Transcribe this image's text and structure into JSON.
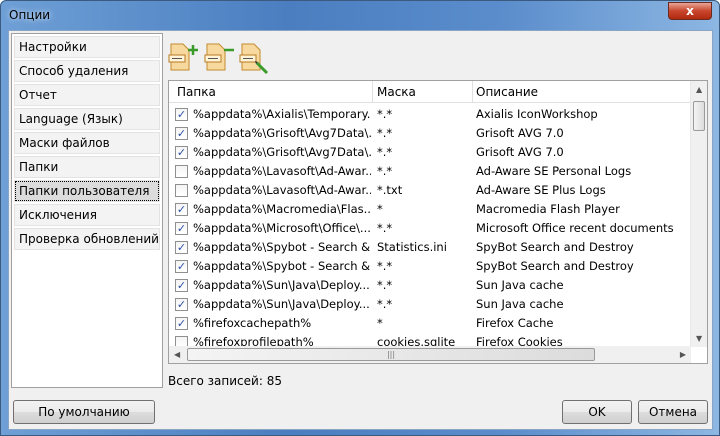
{
  "window": {
    "title": "Опции",
    "close_label": "x"
  },
  "sidebar": {
    "items": [
      {
        "label": "Настройки"
      },
      {
        "label": "Способ удаления"
      },
      {
        "label": "Отчет"
      },
      {
        "label": "Language (Язык)"
      },
      {
        "label": "Маски файлов"
      },
      {
        "label": "Папки"
      },
      {
        "label": "Папки пользователя",
        "selected": true
      },
      {
        "label": "Исключения"
      },
      {
        "label": "Проверка обновлений"
      }
    ]
  },
  "toolbar": {
    "icons": [
      "add-folder-icon",
      "remove-folder-icon",
      "edit-folder-icon"
    ]
  },
  "table": {
    "columns": [
      "Папка",
      "Маска",
      "Описание"
    ],
    "rows": [
      {
        "checked": true,
        "folder": "%appdata%\\Axialis\\Temporary...",
        "mask": "*.*",
        "desc": "Axialis IconWorkshop"
      },
      {
        "checked": true,
        "folder": "%appdata%\\Grisoft\\Avg7Data\\...",
        "mask": "*.*",
        "desc": "Grisoft AVG 7.0"
      },
      {
        "checked": true,
        "folder": "%appdata%\\Grisoft\\Avg7Data\\...",
        "mask": "*.*",
        "desc": "Grisoft AVG 7.0"
      },
      {
        "checked": false,
        "folder": "%appdata%\\Lavasoft\\Ad-Awar...",
        "mask": "*.*",
        "desc": "Ad-Aware SE Personal Logs"
      },
      {
        "checked": false,
        "folder": "%appdata%\\Lavasoft\\Ad-Awar...",
        "mask": "*.txt",
        "desc": "Ad-Aware SE Plus Logs"
      },
      {
        "checked": true,
        "folder": "%appdata%\\Macromedia\\Flas...",
        "mask": "*",
        "desc": "Macromedia Flash Player"
      },
      {
        "checked": true,
        "folder": "%appdata%\\Microsoft\\Office\\...",
        "mask": "*.*",
        "desc": "Microsoft Office recent documents"
      },
      {
        "checked": true,
        "folder": "%appdata%\\Spybot - Search &...",
        "mask": "Statistics.ini",
        "desc": "SpyBot Search and Destroy"
      },
      {
        "checked": true,
        "folder": "%appdata%\\Spybot - Search &...",
        "mask": "*.*",
        "desc": "SpyBot Search and Destroy"
      },
      {
        "checked": true,
        "folder": "%appdata%\\Sun\\Java\\Deploy...",
        "mask": "*.*",
        "desc": "Sun Java cache"
      },
      {
        "checked": true,
        "folder": "%appdata%\\Sun\\Java\\Deploy...",
        "mask": "*.*",
        "desc": "Sun Java cache"
      },
      {
        "checked": true,
        "folder": "%firefoxcachepath%",
        "mask": "*",
        "desc": "Firefox Cache"
      },
      {
        "checked": false,
        "folder": "%firefoxprofilepath%",
        "mask": "cookies.sqlite",
        "desc": "Firefox Cookies"
      }
    ]
  },
  "status": "Всего записей: 85",
  "buttons": {
    "default": "По умолчанию",
    "ok": "OK",
    "cancel": "Отмена"
  },
  "colors": {
    "title_bar": "#4a7ec0",
    "close": "#c8452c"
  }
}
